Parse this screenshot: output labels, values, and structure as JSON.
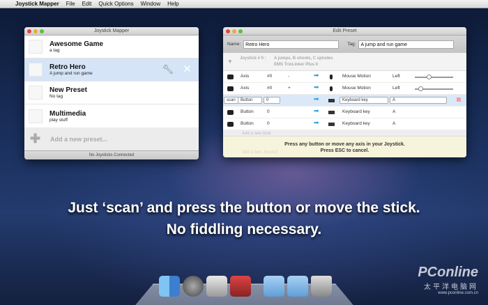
{
  "menubar": {
    "app": "Joystick Mapper",
    "items": [
      "File",
      "Edit",
      "Quick Options",
      "Window",
      "Help"
    ]
  },
  "main_window": {
    "title": "Joystick Mapper",
    "presets": [
      {
        "name": "Awesome Game",
        "tag": "a tag"
      },
      {
        "name": "Retro Hero",
        "tag": "A jump and run game"
      },
      {
        "name": "New Preset",
        "tag": "No tag"
      },
      {
        "name": "Multimedia",
        "tag": "play stuff"
      }
    ],
    "add_label": "Add a new preset...",
    "status": "No Joysticks Connected"
  },
  "edit_window": {
    "title": "Edit Preset",
    "name_label": "Name:",
    "name_value": "Retro Hero",
    "tag_label": "Tag:",
    "tag_value": "A jump and run game",
    "joystick_label": "Joystick # 0 :",
    "joystick_desc": "A jumps, B shoots, C splodes",
    "joystick_device": "EMS TrioLinker Plus II",
    "binds": [
      {
        "type": "Axis",
        "num": "#0",
        "dir": "-",
        "action": "Mouse Motion",
        "value": "Left",
        "slider": 0.3
      },
      {
        "type": "Axis",
        "num": "#0",
        "dir": "+",
        "action": "Mouse Motion",
        "value": "Left",
        "slider": 0.1
      },
      {
        "scan": "scan",
        "type": "Button",
        "num": "0",
        "dir": "",
        "action": "Keyboard key",
        "value": "A"
      },
      {
        "type": "Button",
        "num": "0",
        "dir": "",
        "action": "Keyboard key",
        "value": "A"
      },
      {
        "type": "Button",
        "num": "0",
        "dir": "",
        "action": "Keyboard key",
        "value": "A"
      }
    ],
    "add_bind": "Add a new bind",
    "add_joystick": "Add a new Joystick",
    "overlay_line1": "Press any button or move any axis in your Joystick.",
    "overlay_line2": "Press ESC to cancel."
  },
  "caption": {
    "line1": "Just ‘scan’ and press the button or move the stick.",
    "line2": "No fiddling necessary."
  },
  "watermark": {
    "brand": "PConline",
    "sub": "太平洋电脑网",
    "domain": "www.pconline.com.cn"
  }
}
